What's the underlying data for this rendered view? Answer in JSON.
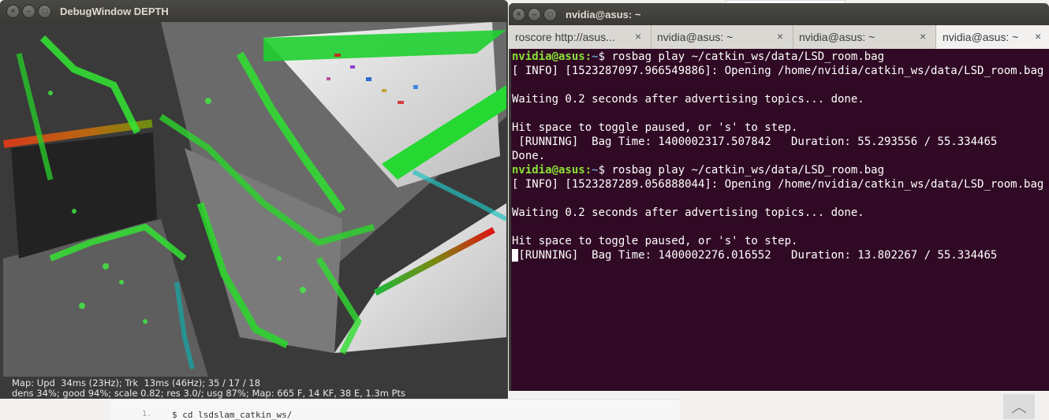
{
  "background": {
    "code_line_number": "1.",
    "code_command": "$ cd lsdslam_catkin_ws/",
    "scroll_top_glyph": "︿"
  },
  "debug_window": {
    "title": "DebugWindow DEPTH",
    "status_line1": "Map: Upd  34ms (23Hz); Trk  13ms (46Hz); 35 / 17 / 18",
    "status_line2": "dens 34%; good 94%; scale 0.82; res 3.0/; usg 87%; Map: 665 F, 14 KF, 38 E, 1.3m Pts"
  },
  "terminal_window": {
    "title": "nvidia@asus: ~",
    "tabs": [
      {
        "label": "roscore http://asus...",
        "close": "×"
      },
      {
        "label": "nvidia@asus: ~",
        "close": "×"
      },
      {
        "label": "nvidia@asus: ~",
        "close": "×"
      },
      {
        "label": "nvidia@asus: ~",
        "close": "×"
      }
    ],
    "lines": [
      {
        "user": "nvidia@asus",
        "sep": ":",
        "path": "~",
        "text": "$ rosbag play ~/catkin_ws/data/LSD_room.bag"
      },
      {
        "text": "[ INFO] [1523287097.966549886]: Opening /home/nvidia/catkin_ws/data/LSD_room.bag"
      },
      {
        "text": ""
      },
      {
        "text": "Waiting 0.2 seconds after advertising topics... done."
      },
      {
        "text": ""
      },
      {
        "text": "Hit space to toggle paused, or 's' to step."
      },
      {
        "text": " [RUNNING]  Bag Time: 1400002317.507842   Duration: 55.293556 / 55.334465"
      },
      {
        "text": "Done."
      },
      {
        "user": "nvidia@asus",
        "sep": ":",
        "path": "~",
        "text": "$ rosbag play ~/catkin_ws/data/LSD_room.bag"
      },
      {
        "text": "[ INFO] [1523287289.056888044]: Opening /home/nvidia/catkin_ws/data/LSD_room.bag"
      },
      {
        "text": ""
      },
      {
        "text": "Waiting 0.2 seconds after advertising topics... done."
      },
      {
        "text": ""
      },
      {
        "text": "Hit space to toggle paused, or 's' to step."
      },
      {
        "cursor": true,
        "text": "[RUNNING]  Bag Time: 1400002276.016552   Duration: 13.802267 / 55.334465"
      }
    ],
    "colors": {
      "background": "#300a24",
      "prompt": "#8ae234",
      "path": "#729fcf",
      "text": "#ffffff"
    }
  },
  "window_buttons": {
    "close": "×",
    "minimize": "–",
    "maximize": "□"
  }
}
